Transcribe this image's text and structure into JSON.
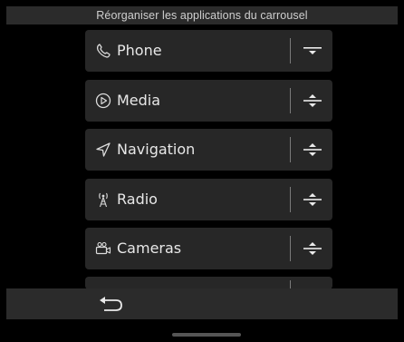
{
  "header": {
    "title": "Réorganiser les applications du carrousel"
  },
  "apps": [
    {
      "label": "Phone",
      "icon": "phone-icon"
    },
    {
      "label": "Media",
      "icon": "play-circle-icon"
    },
    {
      "label": "Navigation",
      "icon": "navigation-arrow-icon"
    },
    {
      "label": "Radio",
      "icon": "radio-tower-icon"
    },
    {
      "label": "Cameras",
      "icon": "camera-icon"
    }
  ],
  "footer": {
    "back_icon": "back-arrow-icon"
  }
}
